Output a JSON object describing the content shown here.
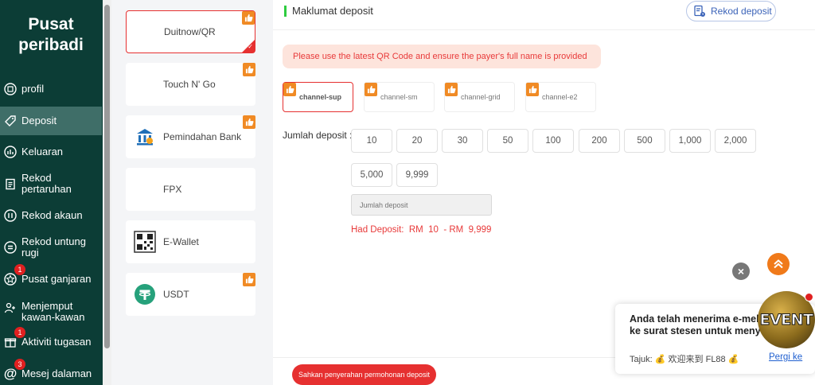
{
  "colors": {
    "sidebar_bg": "#0c3d36",
    "sidebar_active": "#3f6e68",
    "accent_red": "#e63030",
    "badge_orange": "#f08a24",
    "link_blue": "#2060d0"
  },
  "sidebar": {
    "title_line1": "Pusat",
    "title_line2": "peribadi",
    "items": [
      {
        "label": "profil",
        "icon": "profile-icon",
        "badge": null
      },
      {
        "label": "Deposit",
        "icon": "tag-icon",
        "badge": null,
        "active": true
      },
      {
        "label": "Keluaran",
        "icon": "withdraw-icon",
        "badge": null
      },
      {
        "label": "Rekod pertaruhan",
        "icon": "clipboard-icon",
        "badge": null
      },
      {
        "label": "Rekod akaun",
        "icon": "account-record-icon",
        "badge": null
      },
      {
        "label": "Rekod untung rugi",
        "icon": "profit-loss-icon",
        "badge": null
      },
      {
        "label": "Pusat ganjaran",
        "icon": "reward-icon",
        "badge": "1"
      },
      {
        "label": "Menjemput kawan-kawan",
        "icon": "invite-friends-icon",
        "badge": null
      },
      {
        "label": "Aktiviti tugasan",
        "icon": "gift-icon",
        "badge": "1"
      },
      {
        "label": "Mesej dalaman",
        "icon": "at-icon",
        "badge": "3"
      }
    ]
  },
  "methods": [
    {
      "label": "Duitnow/QR",
      "icon": null,
      "thumb": true,
      "selected": true
    },
    {
      "label": "Touch N' Go",
      "icon": null,
      "thumb": true,
      "selected": false
    },
    {
      "label": "Pemindahan Bank",
      "icon": "bank-icon",
      "thumb": true,
      "selected": false
    },
    {
      "label": "FPX",
      "icon": null,
      "thumb": false,
      "selected": false
    },
    {
      "label": "E-Wallet",
      "icon": "qr-code-icon",
      "thumb": false,
      "selected": false
    },
    {
      "label": "USDT",
      "icon": "tether-icon",
      "thumb": true,
      "selected": false
    }
  ],
  "main": {
    "section_title": "Maklumat deposit",
    "rekod_button": "Rekod deposit",
    "notice": "Please use the latest QR Code and ensure the payer's full name is provided",
    "channels": [
      "channel-sup",
      "channel-sm",
      "channel-grid",
      "channel-e2"
    ],
    "selected_channel": "channel-sup",
    "amount_label": "Jumlah deposit :",
    "amounts": [
      "10",
      "20",
      "30",
      "50",
      "100",
      "200",
      "500",
      "1,000",
      "2,000",
      "5,000",
      "9,999"
    ],
    "amount_placeholder": "Jumlah deposit",
    "limit_text": "Had Deposit:  RM  10  - RM  9,999",
    "submit_label": "Sahkan penyerahan permohonan deposit"
  },
  "popup": {
    "message": "Anda telah menerima e-mel, sila pergi ke surat stesen untuk menyemak",
    "subject": "Tajuk: 💰 欢迎来到 FL88 💰",
    "link": "Pergi ke"
  },
  "event_label": "EVENT"
}
